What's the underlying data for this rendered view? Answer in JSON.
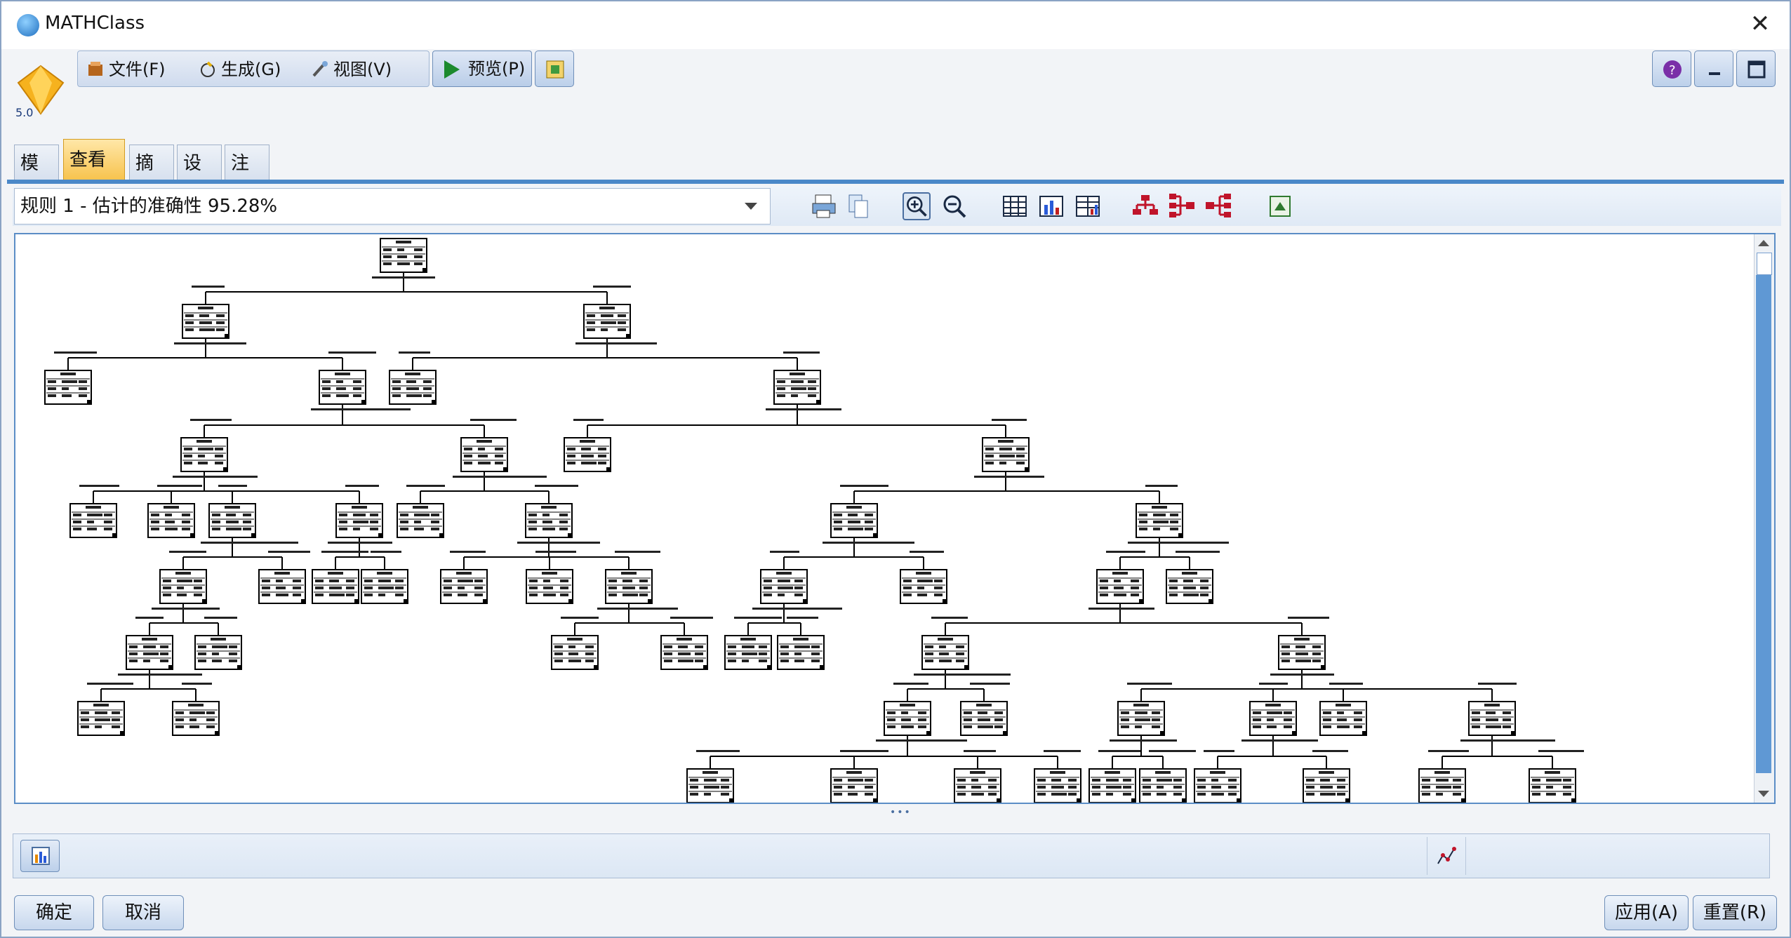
{
  "window": {
    "title": "MATHClass"
  },
  "logo": {
    "version": "5.0"
  },
  "menu": {
    "file": "文件(F)",
    "generate": "生成(G)",
    "view": "视图(V)",
    "preview": "预览(P)"
  },
  "tabs": [
    "模型",
    "查看器",
    "摘要",
    "设置",
    "注解"
  ],
  "active_tab": "查看器",
  "rule_select": {
    "value": "规则 1 - 估计的准确性 95.28%"
  },
  "buttons": {
    "ok": "确定",
    "cancel": "取消",
    "apply": "应用(A)",
    "reset": "重置(R)"
  },
  "colors": {
    "accent": "#4a88c8",
    "tab_active": "#f7c24b",
    "scroll_track": "#5f98d4"
  },
  "icons": {
    "toolbar": [
      "print-icon",
      "copy-icon",
      "zoom-in-icon",
      "zoom-out-icon",
      "table-icon",
      "bar-chart-icon",
      "table-chart-icon",
      "tree-top-down-icon",
      "tree-left-right-icon",
      "tree-right-left-icon",
      "export-icon"
    ]
  }
}
